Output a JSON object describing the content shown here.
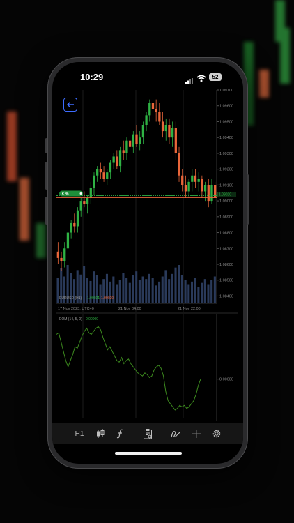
{
  "status_bar": {
    "time": "10:29",
    "battery": "52"
  },
  "symbol_label": "EURUSD (H1)",
  "legend_values": [
    "1.09021",
    "1.09020"
  ],
  "price_badge": "€ %",
  "current_price": "1.09020",
  "indicator_label": "EOM (14, 5, 0)",
  "indicator_value": "0.00000",
  "indicator_axis_label": "0.00000",
  "toolbar": {
    "timeframe": "H1"
  },
  "colors": {
    "bull": "#2fb344",
    "bear": "#e8663a",
    "accent": "#3d6cff",
    "indicator": "#3c8a1e"
  },
  "chart_data": {
    "type": "candlestick",
    "price_axis_ticks": [
      "1.09700",
      "1.09600",
      "1.09500",
      "1.09400",
      "1.09300",
      "1.09200",
      "1.09100",
      "1.09000",
      "1.08900",
      "1.08800",
      "1.08700",
      "1.08600",
      "1.08500",
      "1.08400"
    ],
    "time_axis_labels": [
      "17 Nov 2023, UTC+0",
      "21 Nov 04:00",
      "21 Nov 22:00"
    ],
    "ylim": [
      1.0838,
      1.097
    ],
    "candles": [
      [
        1.0868,
        1.0874,
        1.086,
        1.0864
      ],
      [
        1.0864,
        1.0868,
        1.0856,
        1.0862
      ],
      [
        1.0862,
        1.0874,
        1.0858,
        1.087
      ],
      [
        1.087,
        1.0884,
        1.0866,
        1.088
      ],
      [
        1.088,
        1.0888,
        1.0876,
        1.0886
      ],
      [
        1.0886,
        1.0892,
        1.088,
        1.0884
      ],
      [
        1.0884,
        1.0896,
        1.088,
        1.0894
      ],
      [
        1.0894,
        1.0902,
        1.089,
        1.09
      ],
      [
        1.09,
        1.0906,
        1.0896,
        1.0898
      ],
      [
        1.0898,
        1.0904,
        1.0892,
        1.0902
      ],
      [
        1.0902,
        1.0912,
        1.0898,
        1.0908
      ],
      [
        1.0908,
        1.0918,
        1.0904,
        1.0916
      ],
      [
        1.0916,
        1.0922,
        1.0912,
        1.092
      ],
      [
        1.092,
        1.0924,
        1.0914,
        1.0918
      ],
      [
        1.0918,
        1.0922,
        1.0912,
        1.0914
      ],
      [
        1.0914,
        1.092,
        1.091,
        1.0918
      ],
      [
        1.0918,
        1.0926,
        1.0914,
        1.0924
      ],
      [
        1.0924,
        1.093,
        1.092,
        1.0928
      ],
      [
        1.0928,
        1.0932,
        1.092,
        1.0922
      ],
      [
        1.0922,
        1.0934,
        1.0918,
        1.0932
      ],
      [
        1.0932,
        1.0938,
        1.0926,
        1.093
      ],
      [
        1.093,
        1.094,
        1.0926,
        1.0938
      ],
      [
        1.0938,
        1.0942,
        1.093,
        1.0934
      ],
      [
        1.0934,
        1.0944,
        1.093,
        1.0942
      ],
      [
        1.0942,
        1.0948,
        1.0934,
        1.0936
      ],
      [
        1.0936,
        1.0944,
        1.0932,
        1.094
      ],
      [
        1.094,
        1.095,
        1.0936,
        1.0948
      ],
      [
        1.0948,
        1.0956,
        1.0944,
        1.0954
      ],
      [
        1.0954,
        1.0964,
        1.095,
        1.0962
      ],
      [
        1.0962,
        1.0966,
        1.0954,
        1.0958
      ],
      [
        1.0958,
        1.0964,
        1.095,
        1.0956
      ],
      [
        1.0956,
        1.0962,
        1.0948,
        1.095
      ],
      [
        1.095,
        1.0956,
        1.094,
        1.0944
      ],
      [
        1.0944,
        1.0952,
        1.0938,
        1.0948
      ],
      [
        1.0948,
        1.0952,
        1.0936,
        1.094
      ],
      [
        1.094,
        1.095,
        1.0934,
        1.0946
      ],
      [
        1.0946,
        1.095,
        1.0926,
        1.093
      ],
      [
        1.093,
        1.0934,
        1.0912,
        1.0916
      ],
      [
        1.0916,
        1.092,
        1.0906,
        1.091
      ],
      [
        1.091,
        1.0916,
        1.0902,
        1.0906
      ],
      [
        1.0906,
        1.0914,
        1.0902,
        1.0912
      ],
      [
        1.0912,
        1.092,
        1.0906,
        1.0916
      ],
      [
        1.0916,
        1.092,
        1.0908,
        1.0912
      ],
      [
        1.0912,
        1.0918,
        1.0906,
        1.0914
      ],
      [
        1.0914,
        1.0916,
        1.0902,
        1.0906
      ],
      [
        1.0906,
        1.0912,
        1.09,
        1.091
      ],
      [
        1.091,
        1.0914,
        1.0896,
        1.09
      ],
      [
        1.09,
        1.0914,
        1.0898,
        1.091
      ],
      [
        1.091,
        1.0912,
        1.09,
        1.0902
      ]
    ],
    "volume": [
      40,
      55,
      42,
      60,
      48,
      38,
      52,
      45,
      58,
      40,
      35,
      50,
      44,
      30,
      38,
      46,
      34,
      42,
      30,
      36,
      48,
      40,
      32,
      44,
      50,
      36,
      42,
      38,
      46,
      40,
      28,
      34,
      42,
      52,
      38,
      46,
      56,
      60,
      44,
      36,
      30,
      34,
      40,
      26,
      32,
      38,
      30,
      36,
      42
    ],
    "eom": [
      0.0029,
      0.003,
      0.0024,
      0.0018,
      0.0012,
      0.0008,
      0.0012,
      0.0016,
      0.0021,
      0.002,
      0.0024,
      0.0028,
      0.0031,
      0.0033,
      0.003,
      0.0029,
      0.0031,
      0.0033,
      0.0034,
      0.0032,
      0.0027,
      0.0023,
      0.0019,
      0.0021,
      0.0018,
      0.0015,
      0.0012,
      0.0011,
      0.0014,
      0.001,
      0.0012,
      0.0013,
      0.001,
      0.0008,
      0.0006,
      0.0004,
      0.0003,
      0.0002,
      0.0004,
      0.0003,
      0.0001,
      0.0002,
      0.0006,
      0.0008,
      0.0009,
      0.0007,
      0.0002,
      -0.0008,
      -0.0014,
      -0.0016,
      -0.0018,
      -0.002,
      -0.0019,
      -0.0017,
      -0.0018,
      -0.0017,
      -0.0019,
      -0.0018,
      -0.0016,
      -0.0014,
      -0.001,
      -0.0004,
      0.0
    ]
  }
}
